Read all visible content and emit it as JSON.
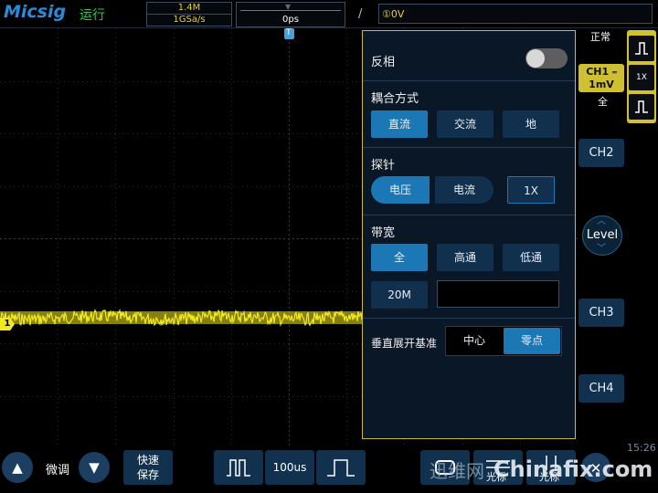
{
  "header": {
    "logo": "Micsig",
    "run_status": "运行",
    "memory_depth": "1.4M",
    "sample_rate": "1GSa/s",
    "trigger_delay": "0ps",
    "trigger_marker": "T",
    "trigger_slope": "/",
    "trigger_level": "①0V"
  },
  "side": {
    "trigger_mode": "正常",
    "ch1_label": "CH1",
    "ch1_coupling_symbol": "═",
    "ch1_scale": "1mV",
    "ch1_bandwidth": "全",
    "ch2": "CH2",
    "ch3": "CH3",
    "ch4": "CH4",
    "level": "Level",
    "probe_quick": "1X"
  },
  "panel": {
    "invert_label": "反相",
    "invert_on": false,
    "coupling_label": "耦合方式",
    "coupling_options": [
      "直流",
      "交流",
      "地"
    ],
    "coupling_selected": "直流",
    "probe_label": "探针",
    "probe_options": [
      "电压",
      "电流"
    ],
    "probe_selected": "电压",
    "probe_ratio": "1X",
    "bandwidth_label": "带宽",
    "bandwidth_options": [
      "全",
      "高通",
      "低通"
    ],
    "bandwidth_selected": "全",
    "bandwidth_limit": "20M",
    "bandwidth_value": "",
    "vertical_ref_label": "垂直展开基准",
    "vertical_ref_options": [
      "中心",
      "零点"
    ],
    "vertical_ref_selected": "零点"
  },
  "waveform": {
    "channel_marker": "1",
    "color": "#f2ea1e"
  },
  "bottom": {
    "fine_label": "微调",
    "quick_save": "快速\n保存",
    "timebase": "100us",
    "cursor_label": "光标",
    "measure_label": "光标",
    "clock": "15:26"
  },
  "watermark": {
    "text": "Chinafix.com",
    "cn": "迅维网"
  },
  "colors": {
    "accent": "#1c78b4",
    "button": "#11304d",
    "ch1": "#cfc033",
    "panel_border": "#c7bc3a"
  }
}
